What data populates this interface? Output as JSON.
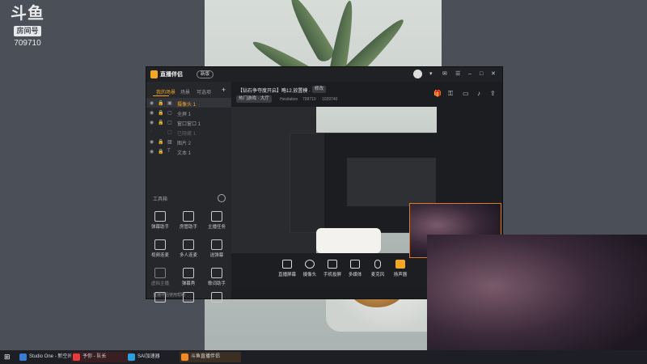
{
  "overlay": {
    "brand_text": "斗鱼",
    "room_label": "房间号",
    "room_number": "709710"
  },
  "app": {
    "name": "直播伴侣",
    "badge": "新版",
    "stream_title": "【钻石争夺度开启】略12.放置模 ·",
    "edit_label": "修改",
    "category_tag": "热门游戏 · 大厅",
    "username": "Hesitation",
    "room_id": "709710",
    "popularity": "1039740",
    "sidebar_tabs": [
      "我的场景",
      "场景",
      "可选项"
    ],
    "sources": [
      {
        "label": "摄像头 1",
        "active": true
      },
      {
        "label": "全屏 1",
        "active": false
      },
      {
        "label": "窗口窗口 1",
        "active": false
      },
      {
        "label": "已隐藏 1",
        "active": false
      },
      {
        "label": "图片 2",
        "active": false
      },
      {
        "label": "文本 1",
        "active": false
      }
    ],
    "toolbox_title": "工具箱",
    "tools": [
      {
        "label": "弹幕助手",
        "icon": "danmaku-icon"
      },
      {
        "label": "房管助手",
        "icon": "user-icon"
      },
      {
        "label": "主播任务",
        "icon": "task-icon"
      },
      {
        "label": "视频连麦",
        "icon": "video-link-icon"
      },
      {
        "label": "多人连麦",
        "icon": "multi-user-icon"
      },
      {
        "label": "送弹幕",
        "icon": "send-icon"
      },
      {
        "label": "虚拟主播",
        "icon": "download-icon"
      },
      {
        "label": "弹幕秀",
        "icon": "show-icon"
      },
      {
        "label": "歌词助手",
        "icon": "lyrics-icon"
      },
      {
        "label": "",
        "icon": "game-icon"
      },
      {
        "label": "",
        "icon": "download-icon"
      },
      {
        "label": "",
        "icon": "car-icon"
      }
    ],
    "bottom_buttons": [
      {
        "label": "直播屏幕",
        "icon": "screen-icon"
      },
      {
        "label": "摄像头",
        "icon": "camera-icon"
      },
      {
        "label": "手机投屏",
        "icon": "phone-icon"
      },
      {
        "label": "多媒体",
        "icon": "media-icon"
      },
      {
        "label": "麦克风",
        "icon": "mic-icon"
      },
      {
        "label": "扬声器",
        "icon": "speaker-icon"
      }
    ],
    "status_text": "直播伴侣使用帮助"
  },
  "taskbar": {
    "items": [
      {
        "label": "Studio One - 新空间",
        "color": "#3a7bd5"
      },
      {
        "label": "予你 - 队长",
        "color": "#e33c3c"
      },
      {
        "label": "SAI加速器",
        "color": "#2aa0e0"
      },
      {
        "label": "斗鱼直播伴侣",
        "color": "#f08a24"
      }
    ]
  },
  "colors": {
    "accent": "#f5a623",
    "brand_orange": "#f08a24",
    "notify_red": "#e33c3c"
  }
}
